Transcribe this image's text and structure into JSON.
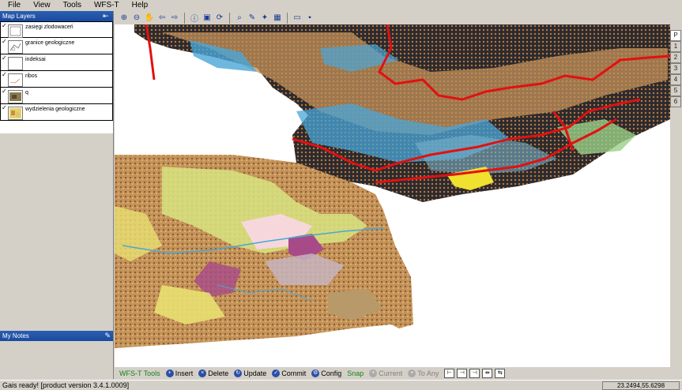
{
  "menu": [
    "File",
    "View",
    "Tools",
    "WFS-T",
    "Help"
  ],
  "map_layers": {
    "title": "Map Layers",
    "layers": [
      {
        "name": "zasięgi zlodowaceń",
        "checked": "✓"
      },
      {
        "name": "granice geologiczne",
        "checked": "✓"
      },
      {
        "name": "indeksai",
        "checked": "✓"
      },
      {
        "name": "ribos",
        "checked": "✓"
      },
      {
        "name": "q",
        "checked": "✓"
      },
      {
        "name": "wydzielenia geologiczne",
        "checked": "✓"
      }
    ]
  },
  "notes": {
    "title": "My Notes"
  },
  "right_tabs": [
    "P",
    "1",
    "2",
    "3",
    "4",
    "5",
    "6"
  ],
  "wfs": {
    "title": "WFS-T Tools",
    "insert": "Insert",
    "delete": "Delete",
    "update": "Update",
    "commit": "Commit",
    "config": "Config",
    "snap": "Snap",
    "current": "Current",
    "to_any": "To Any"
  },
  "status": {
    "message": "Gais ready! [product version 3.4.1.0009]",
    "coords": "23.2494,55.6298"
  },
  "colors": {
    "title_bar": "#1a4aa0",
    "map_border_red": "#e31010",
    "map_blue": "#4aa6d8",
    "map_brown": "#c4915a",
    "map_dark": "#2b2a30"
  }
}
